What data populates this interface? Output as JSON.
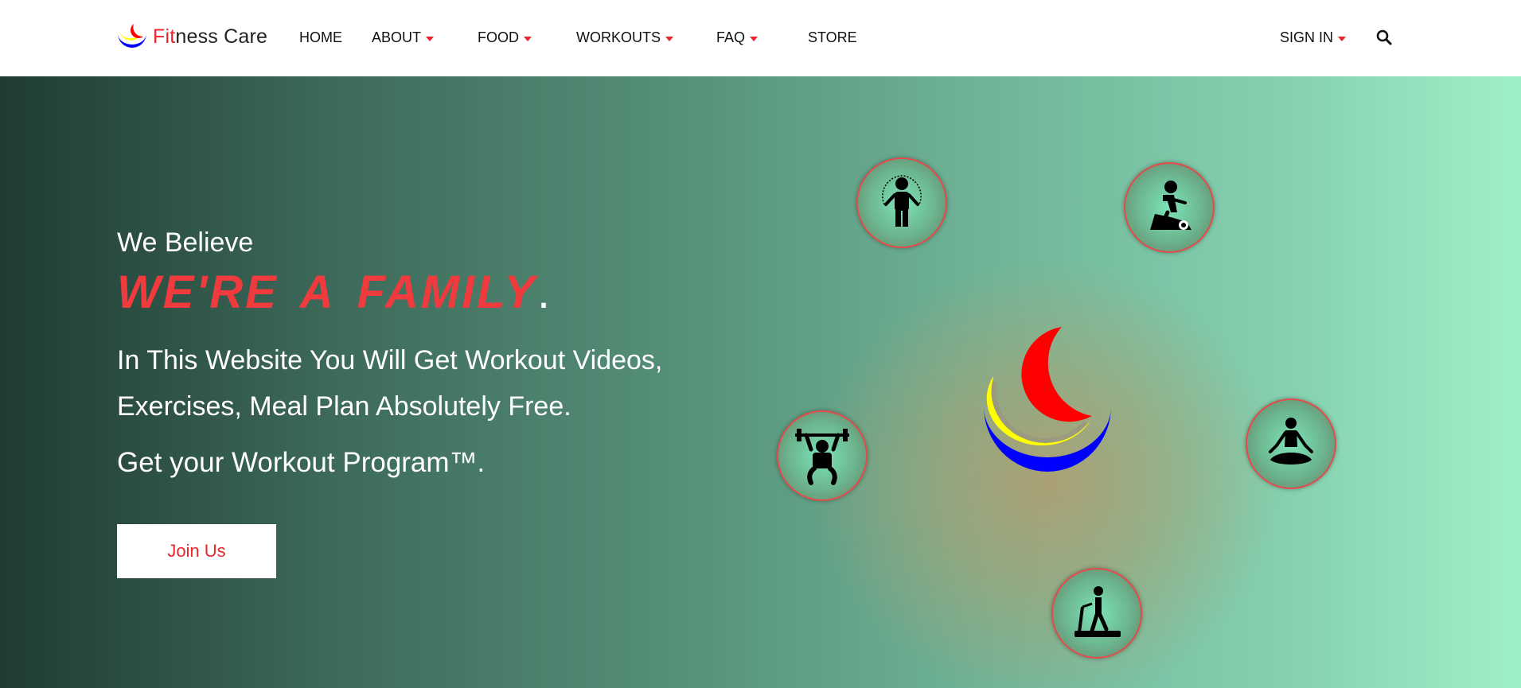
{
  "brand": {
    "name_accent": "Fit",
    "name_rest": "ness Care"
  },
  "nav": {
    "home": "HOME",
    "about": "ABOUT",
    "food": "FOOD",
    "workouts": "WORKOUTS",
    "faq": "FAQ",
    "store": "STORE",
    "sign_in": "SIGN IN"
  },
  "hero": {
    "we_believe": "We Believe",
    "family": "WE'RE  A  FAMILY",
    "family_dot": ".",
    "description": "In This Website You Will Get Workout Videos, Exercises, Meal Plan Absolutely Free.",
    "program": "Get your Workout Program™.",
    "join_label": "Join Us"
  },
  "icons": {
    "jump_rope": "jump-rope-icon",
    "cycling": "stationary-bike-icon",
    "weightlifting": "weightlifting-icon",
    "yoga": "meditation-icon",
    "treadmill": "treadmill-icon",
    "search": "search-icon"
  },
  "colors": {
    "accent": "#e8262c",
    "logo_red": "#ff0000",
    "logo_yellow": "#ffff00",
    "logo_blue": "#0000ff"
  }
}
